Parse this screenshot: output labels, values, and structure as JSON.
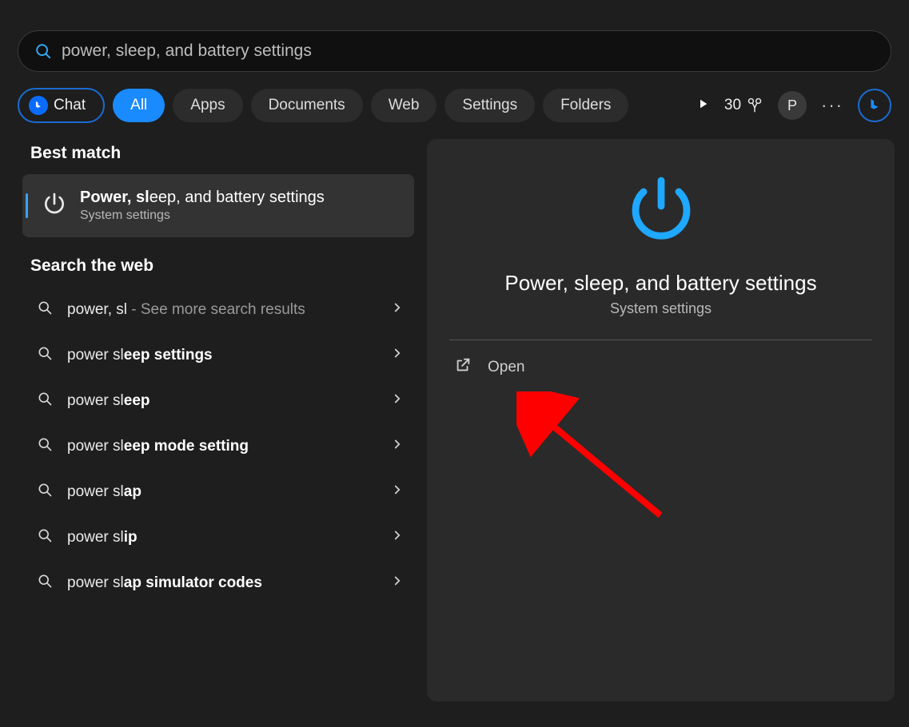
{
  "search": {
    "value": "power, sleep, and battery settings"
  },
  "filters": {
    "chat": "Chat",
    "all": "All",
    "apps": "Apps",
    "documents": "Documents",
    "web": "Web",
    "settings": "Settings",
    "folders": "Folders"
  },
  "header": {
    "points": "30",
    "avatar_letter": "P"
  },
  "left": {
    "best_match_heading": "Best match",
    "best_match": {
      "title_pre": "Power",
      "title_mid": ", sl",
      "title_post": "eep, and battery settings",
      "subtitle": "System settings"
    },
    "search_web_heading": "Search the web",
    "items": [
      {
        "pre": "power",
        "mid": ", sl",
        "post": "",
        "tail": " - See more search results"
      },
      {
        "pre": "power sl",
        "mid": "",
        "post": "eep settings",
        "tail": ""
      },
      {
        "pre": "power sl",
        "mid": "",
        "post": "eep",
        "tail": ""
      },
      {
        "pre": "power sl",
        "mid": "",
        "post": "eep mode setting",
        "tail": ""
      },
      {
        "pre": "power sl",
        "mid": "",
        "post": "ap",
        "tail": ""
      },
      {
        "pre": "power sl",
        "mid": "",
        "post": "ip",
        "tail": ""
      },
      {
        "pre": "power sl",
        "mid": "",
        "post": "ap simulator codes",
        "tail": ""
      }
    ]
  },
  "preview": {
    "title": "Power, sleep, and battery settings",
    "subtitle": "System settings",
    "open_label": "Open"
  },
  "colors": {
    "accent": "#1b9af5"
  }
}
